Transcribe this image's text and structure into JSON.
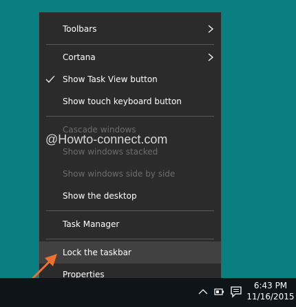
{
  "watermark": "@Howto-connect.com",
  "menu": {
    "toolbars": "Toolbars",
    "cortana": "Cortana",
    "show_task_view": "Show Task View button",
    "show_touch_keyboard": "Show touch keyboard button",
    "cascade_windows": "Cascade windows",
    "show_windows_stacked": "Show windows stacked",
    "show_windows_side_by_side": "Show windows side by side",
    "show_desktop": "Show the desktop",
    "task_manager": "Task Manager",
    "lock_taskbar": "Lock the taskbar",
    "properties": "Properties"
  },
  "clock": {
    "time": "6:43 PM",
    "date": "11/16/2015"
  },
  "colors": {
    "desktop": "#0a7f82",
    "menu_bg": "#2b2b2b",
    "highlight": "#414141",
    "arrow": "#f07030",
    "taskbar": "#0f1419"
  },
  "icons": [
    "check-icon",
    "chevron-right-icon",
    "chevron-up-icon",
    "battery-icon",
    "action-center-icon"
  ]
}
